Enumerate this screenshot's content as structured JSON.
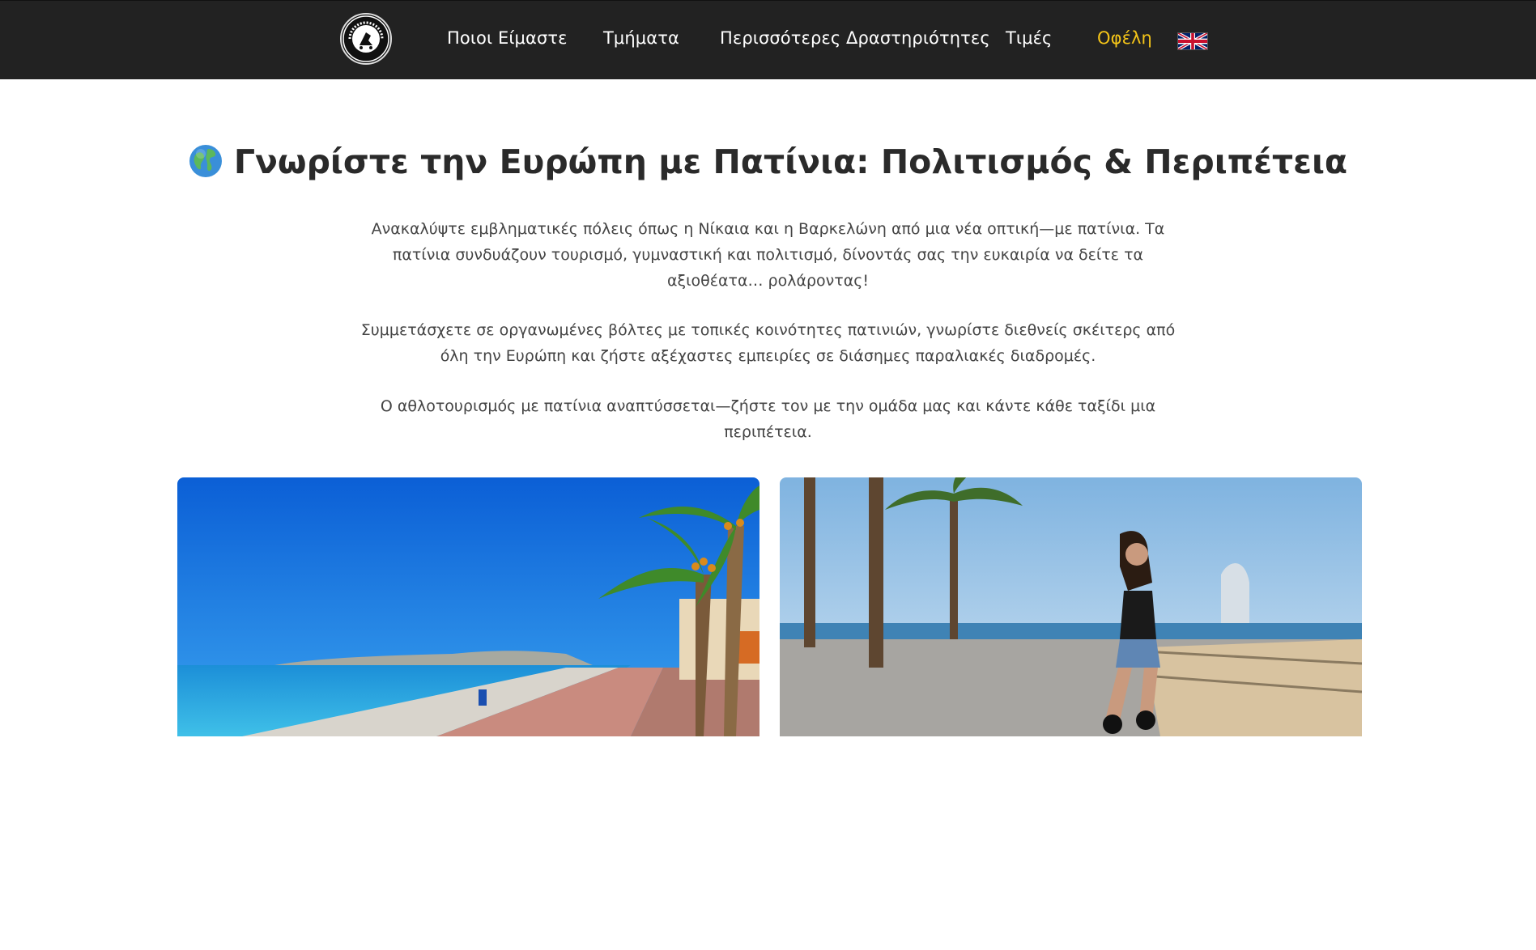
{
  "nav": {
    "logo_text": "HERMES ROLLERSKATE",
    "items": [
      {
        "label": "Ποιοι Είμαστε"
      },
      {
        "label": "Τμήματα"
      },
      {
        "label": "Περισσότερες Δραστηριότητες"
      },
      {
        "label": "Τιμές"
      },
      {
        "label": "Οφέλη",
        "active": true
      }
    ],
    "language_icon": "uk-flag-icon",
    "active_color": "#f5c518",
    "background_color": "#222222"
  },
  "main": {
    "title_icon": "globe-icon",
    "title": "Γνωρίστε την Ευρώπη με Πατίνια: Πολιτισμός & Περιπέτεια",
    "paragraphs": [
      "Ανακαλύψτε εμβληματικές πόλεις όπως η Νίκαια και η Βαρκελώνη από μια νέα οπτική—με πατίνια. Τα πατίνια συνδυάζουν τουρισμό, γυμναστική και πολιτισμό, δίνοντάς σας την ευκαιρία να δείτε τα αξιοθέατα… ρολάροντας!",
      "Συμμετάσχετε σε οργανωμένες βόλτες με τοπικές κοινότητες πατινιών, γνωρίστε διεθνείς σκέιτερς από όλη την Ευρώπη και ζήστε αξέχαστες εμπειρίες σε διάσημες παραλιακές διαδρομές.",
      "Ο αθλοτουρισμός με πατίνια αναπτύσσεται—ζήστε τον με την ομάδα μας και κάντε κάθε ταξίδι μια περιπέτεια."
    ],
    "images": [
      {
        "subject": "nice-promenade-photo"
      },
      {
        "subject": "barcelona-skater-photo"
      }
    ]
  }
}
